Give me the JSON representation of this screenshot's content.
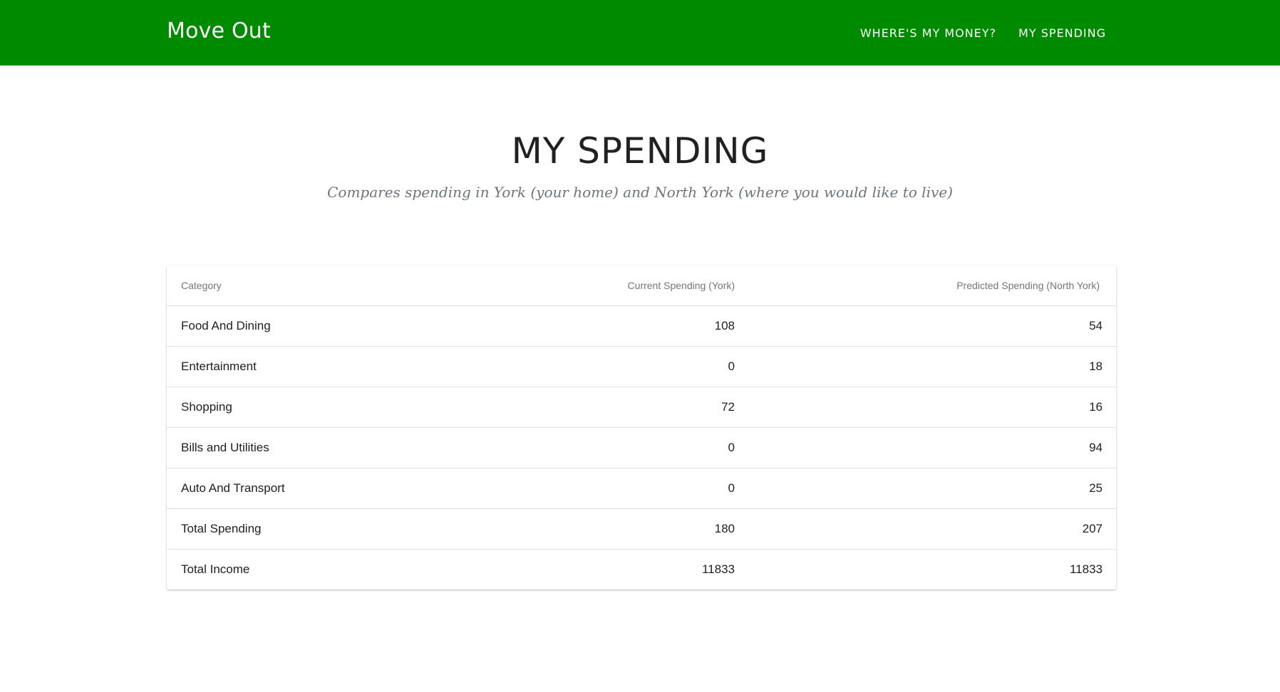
{
  "navbar": {
    "brand": "Move Out",
    "links": [
      {
        "label": "WHERE'S MY MONEY?"
      },
      {
        "label": "MY SPENDING"
      }
    ]
  },
  "page": {
    "title": "MY SPENDING",
    "subtitle": "Compares spending in York (your home) and North York (where you would like to live)"
  },
  "table": {
    "headers": {
      "category": "Category",
      "current": "Current Spending (York)",
      "predicted": "Predicted Spending (North York)"
    },
    "rows": [
      {
        "category": "Food And Dining",
        "current": "108",
        "predicted": "54"
      },
      {
        "category": "Entertainment",
        "current": "0",
        "predicted": "18"
      },
      {
        "category": "Shopping",
        "current": "72",
        "predicted": "16"
      },
      {
        "category": "Bills and Utilities",
        "current": "0",
        "predicted": "94"
      },
      {
        "category": "Auto And Transport",
        "current": "0",
        "predicted": "25"
      },
      {
        "category": "Total Spending",
        "current": "180",
        "predicted": "207"
      },
      {
        "category": "Total Income",
        "current": "11833",
        "predicted": "11833"
      }
    ]
  },
  "colors": {
    "navbar_bg": "#008a00",
    "nav_text": "#ffffff",
    "subtitle_text": "#6c757d"
  }
}
